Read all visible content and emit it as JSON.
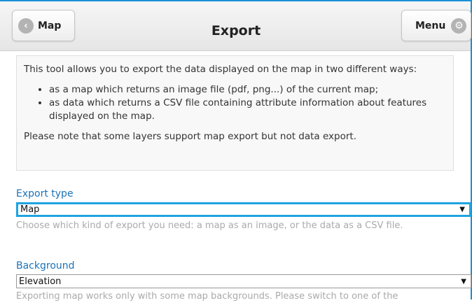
{
  "header": {
    "title": "Export",
    "back_label": "Map",
    "back_icon": "chevron-left-icon",
    "menu_label": "Menu",
    "menu_icon": "gear-icon"
  },
  "info": {
    "intro": "This tool allows you to export the data displayed on the map in two different ways:",
    "bullets": [
      "as a map which returns an image file (pdf, png...) of the current map;",
      "as data which returns a CSV file containing attribute information about features displayed on the map."
    ],
    "note": "Please note that some layers support map export but not data export."
  },
  "export_type": {
    "label": "Export type",
    "value": "Map",
    "help": "Choose which kind of export you need: a map as an image, or the data as a CSV file."
  },
  "background": {
    "label": "Background",
    "value": "Elevation",
    "help": "Exporting map works only with some map backgrounds. Please switch to one of the"
  },
  "colors": {
    "accent": "#1fa3e0",
    "label_blue": "#1a73b8",
    "help_gray": "#aaaaaa"
  }
}
